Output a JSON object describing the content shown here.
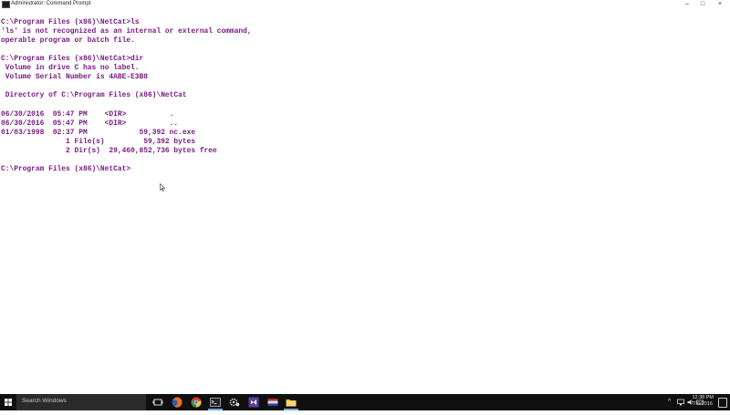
{
  "window": {
    "title": "Administrator: Command Prompt",
    "controls": {
      "minimize": "–",
      "maximize": "□",
      "close": "×"
    }
  },
  "console": {
    "lines": [
      "C:\\Program Files (x86)\\NetCat>ls",
      "'ls' is not recognized as an internal or external command,",
      "operable program or batch file.",
      "",
      "C:\\Program Files (x86)\\NetCat>dir",
      " Volume in drive C has no label.",
      " Volume Serial Number is 4ABE-E3B8",
      "",
      " Directory of C:\\Program Files (x86)\\NetCat",
      "",
      "06/30/2016  05:47 PM    <DIR>          .",
      "06/30/2016  05:47 PM    <DIR>          ..",
      "01/03/1998  02:37 PM            59,392 nc.exe",
      "               1 File(s)         59,392 bytes",
      "               2 Dir(s)  29,460,852,736 bytes free",
      "",
      "C:\\Program Files (x86)\\NetCat>"
    ],
    "text_color": "#7a1c82"
  },
  "taskbar": {
    "search_placeholder": "Search Windows",
    "apps": [
      {
        "name": "task-view"
      },
      {
        "name": "firefox"
      },
      {
        "name": "chrome"
      },
      {
        "name": "command-prompt",
        "active": true
      },
      {
        "name": "settings"
      },
      {
        "name": "visual-studio"
      },
      {
        "name": "app-red-blue"
      },
      {
        "name": "file-explorer",
        "active": true
      }
    ],
    "clock": {
      "time": "12:38 PM",
      "date": "7/6/2016"
    }
  }
}
